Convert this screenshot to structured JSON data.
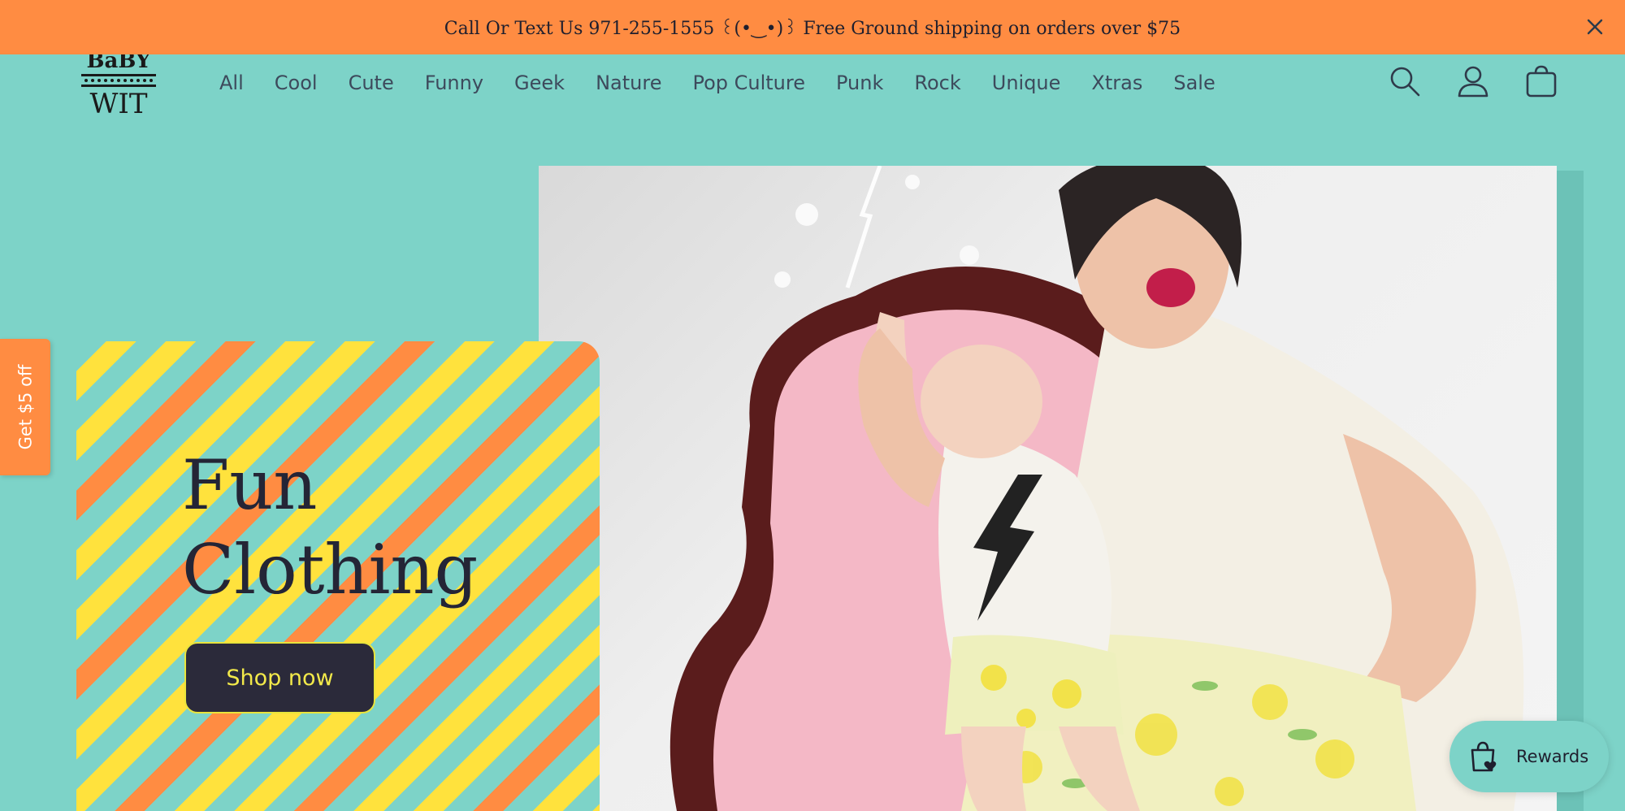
{
  "announcement": {
    "text": "Call Or Text Us 971-255-1555 ꒰(•‿•)꒱ Free Ground shipping on orders over $75"
  },
  "brand": {
    "logo_line1": "BaBY",
    "logo_line2": "WIT"
  },
  "nav": {
    "items": [
      {
        "label": "All"
      },
      {
        "label": "Cool"
      },
      {
        "label": "Cute"
      },
      {
        "label": "Funny"
      },
      {
        "label": "Geek"
      },
      {
        "label": "Nature"
      },
      {
        "label": "Pop Culture"
      },
      {
        "label": "Punk"
      },
      {
        "label": "Rock"
      },
      {
        "label": "Unique"
      },
      {
        "label": "Xtras"
      },
      {
        "label": "Sale"
      }
    ]
  },
  "header_icons": [
    "search-icon",
    "account-icon",
    "cart-icon"
  ],
  "side_tab": {
    "label": "Get $5 off"
  },
  "promo": {
    "title_line1": "Fun",
    "title_line2": "Clothing",
    "button_label": "Shop now"
  },
  "rewards": {
    "label": "Rewards"
  },
  "colors": {
    "background": "#7dd3c8",
    "accent_orange": "#ff8c42",
    "accent_yellow": "#ffe23d",
    "dark": "#2b2a3a"
  }
}
